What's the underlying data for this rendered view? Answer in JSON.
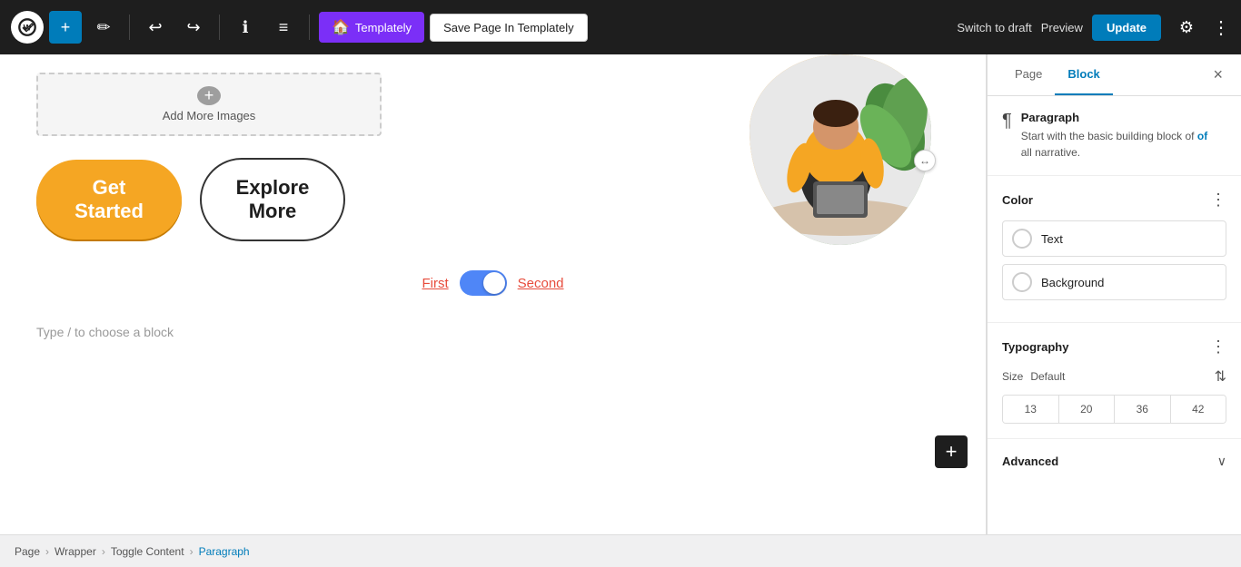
{
  "topbar": {
    "wp_logo_alt": "WordPress",
    "add_label": "+",
    "pencil_label": "✏",
    "undo_label": "↩",
    "redo_label": "↪",
    "info_label": "ℹ",
    "menu_label": "≡",
    "templately_label": "Templately",
    "save_page_label": "Save Page In Templately",
    "switch_draft_label": "Switch to draft",
    "preview_label": "Preview",
    "update_label": "Update",
    "gear_label": "⚙",
    "more_label": "⋮"
  },
  "canvas": {
    "add_images_label": "Add More Images",
    "btn_get_started": "Get\nStarted",
    "btn_explore_more": "Explore\nMore",
    "toggle_first": "First",
    "toggle_second": "Second",
    "type_placeholder": "Type / to choose a block",
    "add_block_label": "+"
  },
  "panel": {
    "page_tab": "Page",
    "block_tab": "Block",
    "close_label": "×",
    "paragraph_icon": "¶",
    "block_name": "Paragraph",
    "block_description_part1": "Start with the basic building block of",
    "block_description_part2": "all narrative.",
    "color_label": "Color",
    "text_label": "Text",
    "background_label": "Background",
    "typography_label": "Typography",
    "size_label": "Size",
    "size_default": "Default",
    "size_13": "13",
    "size_20": "20",
    "size_36": "36",
    "size_42": "42",
    "advanced_label": "Advanced"
  },
  "breadcrumb": {
    "items": [
      {
        "label": "Page",
        "active": false
      },
      {
        "label": "Wrapper",
        "active": false
      },
      {
        "label": "Toggle Content",
        "active": false
      },
      {
        "label": "Paragraph",
        "active": true
      }
    ],
    "sep": "›"
  }
}
